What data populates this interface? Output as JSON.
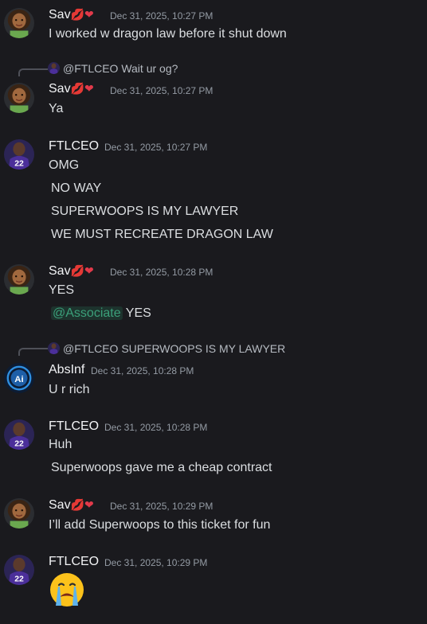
{
  "users": {
    "sav": {
      "name": "Sav",
      "badges": [
        "💋",
        "❤"
      ]
    },
    "ftl": {
      "name": "FTLCEO"
    },
    "abs": {
      "name": "AbsInf"
    }
  },
  "messages": [
    {
      "ts": "Dec 31, 2025, 10:27 PM",
      "lines": [
        "I worked w dragon law before it shut down"
      ]
    },
    {
      "reply": "@FTLCEO Wait ur og?",
      "ts": "Dec 31, 2025, 10:27 PM",
      "lines": [
        "Ya"
      ]
    },
    {
      "ts": "Dec 31, 2025, 10:27 PM",
      "lines": [
        "OMG",
        "NO WAY",
        "SUPERWOOPS IS MY LAWYER",
        "WE MUST RECREATE DRAGON LAW"
      ]
    },
    {
      "ts": "Dec 31, 2025, 10:28 PM",
      "lines": [
        "YES"
      ],
      "mention": "@Associate",
      "mention_rest": "YES"
    },
    {
      "reply": "@FTLCEO SUPERWOOPS IS MY LAWYER",
      "ts": "Dec 31, 2025, 10:28 PM",
      "lines": [
        "U r rich"
      ]
    },
    {
      "ts": "Dec 31, 2025, 10:28 PM",
      "lines": [
        "Huh",
        "Superwoops gave me a cheap contract"
      ]
    },
    {
      "ts": "Dec 31, 2025, 10:29 PM",
      "lines": [
        "I’ll add Superwoops to this ticket for fun"
      ]
    },
    {
      "ts": "Dec 31, 2025, 10:29 PM",
      "emoji": "crying-face"
    }
  ],
  "avatar_text": {
    "ftl_jersey": "22",
    "abs_logo": "Ai"
  },
  "colors": {
    "background": "#1a1a1e",
    "mention_text": "#3ba07a",
    "timestamp": "#949ba4"
  }
}
